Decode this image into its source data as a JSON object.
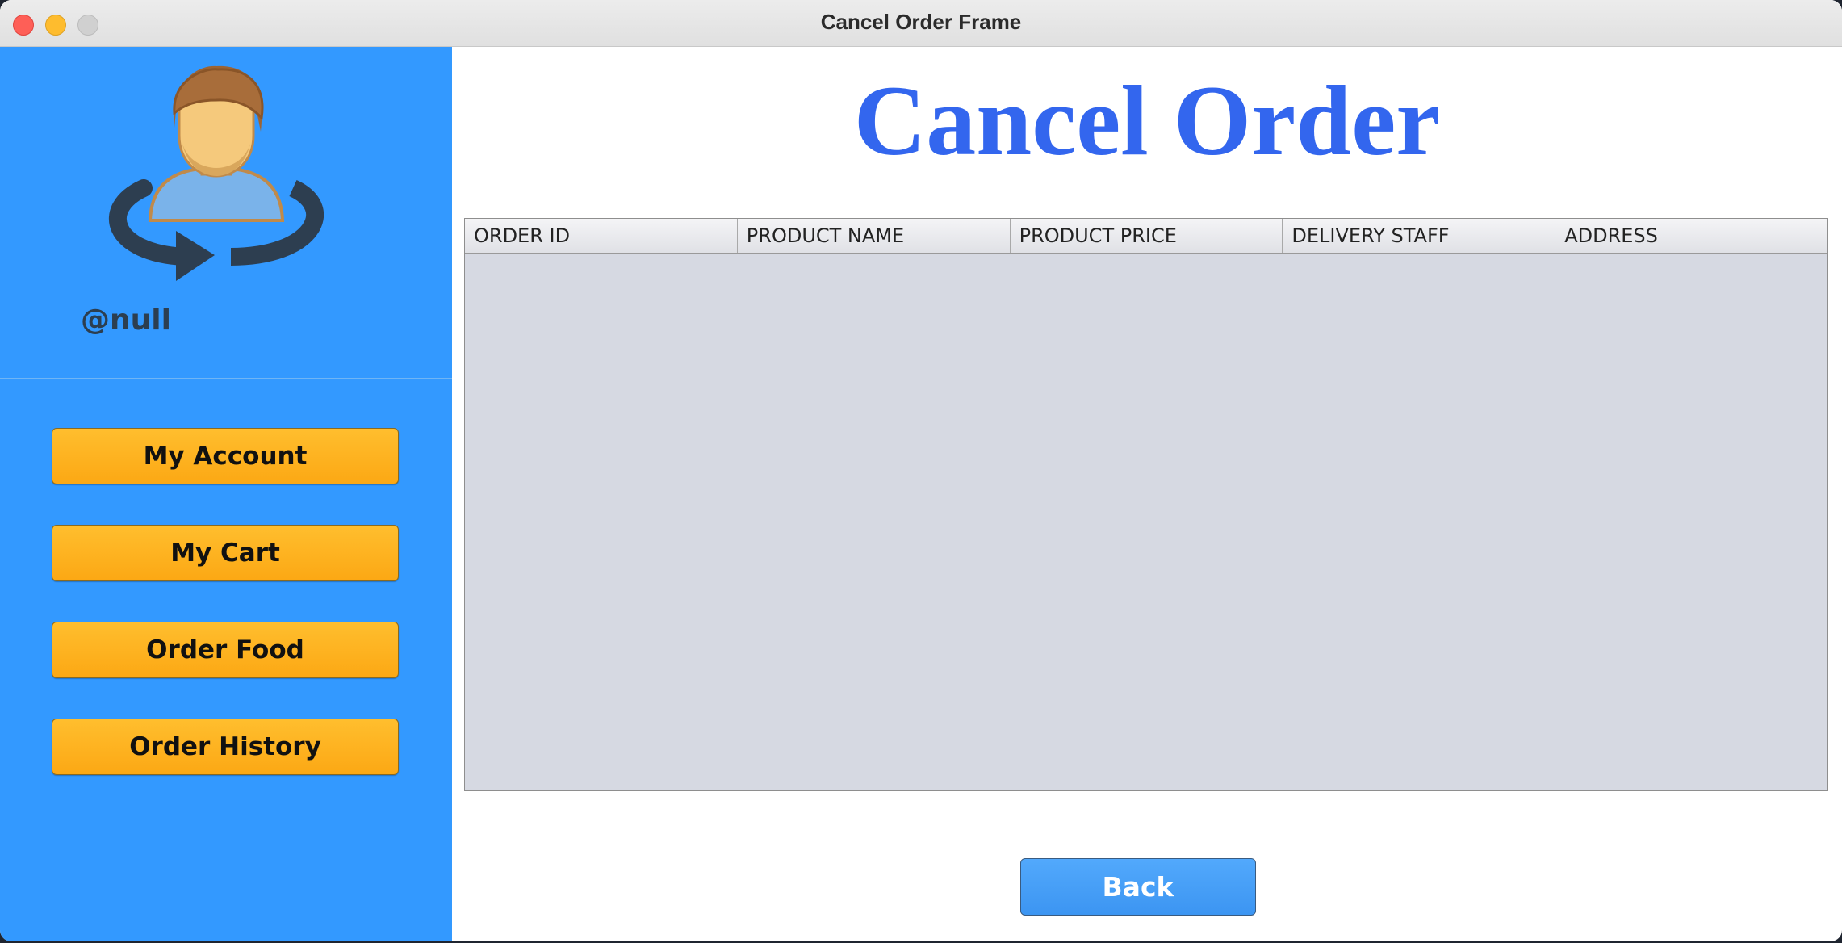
{
  "window": {
    "title": "Cancel Order Frame"
  },
  "sidebar": {
    "avatar_icon": "user-refresh-icon",
    "username": "@null",
    "buttons": [
      {
        "label": "My Account"
      },
      {
        "label": "My Cart"
      },
      {
        "label": "Order Food"
      },
      {
        "label": "Order History"
      }
    ]
  },
  "main": {
    "title": "Cancel Order",
    "table": {
      "columns": [
        "ORDER ID",
        "PRODUCT NAME",
        "PRODUCT PRICE",
        "DELIVERY STAFF",
        "ADDRESS"
      ],
      "rows": []
    },
    "back_label": "Back"
  },
  "colors": {
    "sidebar_bg": "#3399ff",
    "title_color": "#3366ee",
    "nav_button": "#fcb11f",
    "back_button": "#4aa2fa",
    "table_bg": "#d6d9e2"
  }
}
